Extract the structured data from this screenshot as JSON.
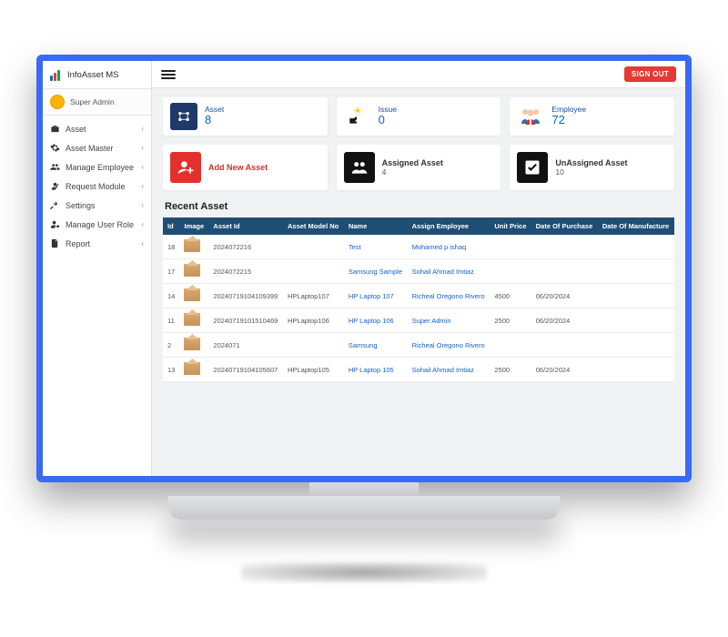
{
  "brand": {
    "title": "InfoAsset MS"
  },
  "user": {
    "role": "Super Admin"
  },
  "sidebar": {
    "items": [
      {
        "label": "Asset"
      },
      {
        "label": "Asset Master"
      },
      {
        "label": "Manage Employee"
      },
      {
        "label": "Request Module"
      },
      {
        "label": "Settings"
      },
      {
        "label": "Manage User Role"
      },
      {
        "label": "Report"
      }
    ]
  },
  "topbar": {
    "signout": "SIGN OUT"
  },
  "stats": [
    {
      "label": "Asset",
      "value": "8"
    },
    {
      "label": "Issue",
      "value": "0"
    },
    {
      "label": "Employee",
      "value": "72"
    }
  ],
  "actions": [
    {
      "title": "Add New Asset",
      "sub": ""
    },
    {
      "title": "Assigned Asset",
      "sub": "4"
    },
    {
      "title": "UnAssigned Asset",
      "sub": "10"
    }
  ],
  "recent": {
    "title": "Recent Asset",
    "headers": [
      "Id",
      "Image",
      "Asset Id",
      "Asset Model No",
      "Name",
      "Assign Employee",
      "Unit Price",
      "Date Of Purchase",
      "Date Of Manufacture"
    ],
    "rows": [
      {
        "id": "18",
        "asset_id": "2024072216",
        "model": "",
        "name": "Test",
        "employee": "Mohamed p ishaq",
        "price": "",
        "purchase": "",
        "manufacture": ""
      },
      {
        "id": "17",
        "asset_id": "2024072215",
        "model": "",
        "name": "Samsung Sample",
        "employee": "Sohail Ahmad Imtiaz",
        "price": "",
        "purchase": "",
        "manufacture": ""
      },
      {
        "id": "14",
        "asset_id": "20240719104109399",
        "model": "HPLaptop107",
        "name": "HP Laptop 107",
        "employee": "Richeal Oregono Rivero",
        "price": "4500",
        "purchase": "06/20/2024",
        "manufacture": ""
      },
      {
        "id": "11",
        "asset_id": "20240719101510469",
        "model": "HPLaptop106",
        "name": "HP Laptop 106",
        "employee": "Super Admin",
        "price": "2500",
        "purchase": "06/20/2024",
        "manufacture": ""
      },
      {
        "id": "2",
        "asset_id": "2024071",
        "model": "",
        "name": "Samsung",
        "employee": "Richeal Oregono Rivero",
        "price": "",
        "purchase": "",
        "manufacture": ""
      },
      {
        "id": "13",
        "asset_id": "20240719104105607",
        "model": "HPLaptop105",
        "name": "HP Laptop 105",
        "employee": "Sohail Ahmad Imtiaz",
        "price": "2500",
        "purchase": "06/20/2024",
        "manufacture": ""
      }
    ]
  }
}
